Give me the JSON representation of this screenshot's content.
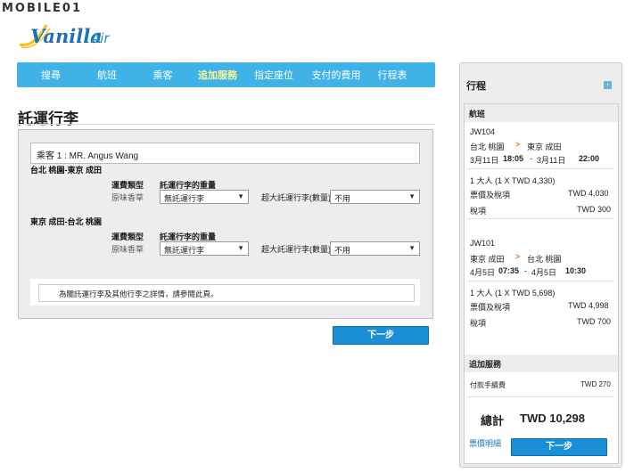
{
  "watermark": "MOBILE01",
  "logo": {
    "word1": "Vanilla",
    "word2": "Air"
  },
  "nav": [
    {
      "label": "搜尋",
      "active": false
    },
    {
      "label": "航班",
      "active": false
    },
    {
      "label": "乘客",
      "active": false
    },
    {
      "label": "追加服務",
      "active": true
    },
    {
      "label": "指定座位",
      "active": false
    },
    {
      "label": "支付的費用",
      "active": false
    },
    {
      "label": "行程表",
      "active": false
    }
  ],
  "page_title": "託運行李",
  "passenger": "乘客 1 : MR. Angus Wang",
  "segments": [
    {
      "route": "台北 桃園-東京 成田",
      "fare_type_label": "運費類型",
      "fare_type_value": "原味香草",
      "weight_label": "託運行李的重量",
      "weight_value": "無託運行李",
      "oversize_label": "超大託運行李(數量)",
      "oversize_value": "不用"
    },
    {
      "route": "東京 成田-台北 桃園",
      "fare_type_label": "運費類型",
      "fare_type_value": "原味香草",
      "weight_label": "託運行李的重量",
      "weight_value": "無託運行李",
      "oversize_label": "超大託運行李(數量)",
      "oversize_value": "不用"
    }
  ],
  "note": "為關託運行李及其他行李之詳情，請參閱此頁。",
  "next_label": "下一步",
  "sidebar": {
    "title": "行程",
    "flight_header": "航班",
    "flights": [
      {
        "code": "JW104",
        "from": "台北 桃園",
        "arrow": ">",
        "to": "東京 成田",
        "dep_date": "3月11日",
        "dep_time": "18:05",
        "sep": "-",
        "arr_date": "3月11日",
        "arr_time": "22:00",
        "pax": "1 大人 (1 X TWD 4,330)",
        "fare_label": "票價及稅項",
        "fare_value": "TWD 4,030",
        "tax_label": "稅項",
        "tax_value": "TWD 300"
      },
      {
        "code": "JW101",
        "from": "東京 成田",
        "arrow": ">",
        "to": "台北 桃園",
        "dep_date": "4月5日",
        "dep_time": "07:35",
        "sep": "-",
        "arr_date": "4月5日",
        "arr_time": "10:30",
        "pax": "1 大人 (1 X TWD 5,698)",
        "fare_label": "票價及稅項",
        "fare_value": "TWD 4,998",
        "tax_label": "稅項",
        "tax_value": "TWD 700"
      }
    ],
    "extras_header": "追加服務",
    "fee_label": "付款手續費",
    "fee_value": "TWD 270",
    "total_label": "總計",
    "total_value": "TWD 10,298",
    "details_link": "票價明細",
    "next_label": "下一步"
  },
  "colors": {
    "nav": "#3fb3e8",
    "active_nav": "#fff59a",
    "button": "#1a8fd8",
    "arrow": "#e0801c"
  }
}
